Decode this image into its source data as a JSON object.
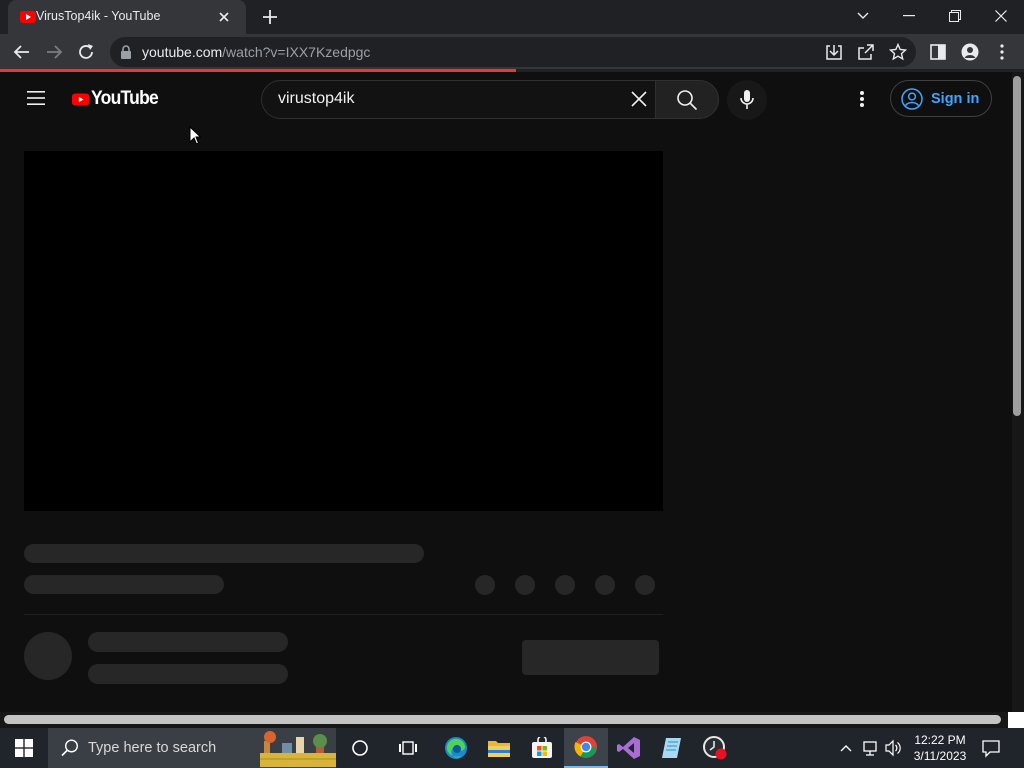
{
  "browser": {
    "tab_title": "VirusTop4ik - YouTube",
    "url_host": "youtube.com",
    "url_path": "/watch?v=IXX7Kzedpgc"
  },
  "youtube": {
    "logo_text": "YouTube",
    "search_value": "virustop4ik",
    "signin_label": "Sign in"
  },
  "taskbar": {
    "search_placeholder": "Type here to search",
    "time": "12:22 PM",
    "date": "3/11/2023"
  },
  "colors": {
    "accent_red": "#ff0000",
    "signin_blue": "#3ea6ff",
    "load_bar": "#e53935"
  },
  "icons": [
    "youtube-favicon",
    "close-icon",
    "plus-icon",
    "chevron-down-icon",
    "minimize-icon",
    "restore-icon",
    "back-icon",
    "forward-icon",
    "reload-icon",
    "lock-icon",
    "install-icon",
    "share-icon",
    "star-icon",
    "sidepanel-icon",
    "profile-icon",
    "kebab-icon",
    "hamburger-icon",
    "search-icon",
    "mic-icon",
    "account-icon",
    "windows-icon",
    "cortana-icon",
    "taskview-icon",
    "edge-icon",
    "explorer-icon",
    "store-icon",
    "chrome-icon",
    "visual-studio-icon",
    "notepad-icon",
    "clock-app-icon",
    "chevron-up-icon",
    "network-icon",
    "volume-icon",
    "notifications-icon"
  ]
}
